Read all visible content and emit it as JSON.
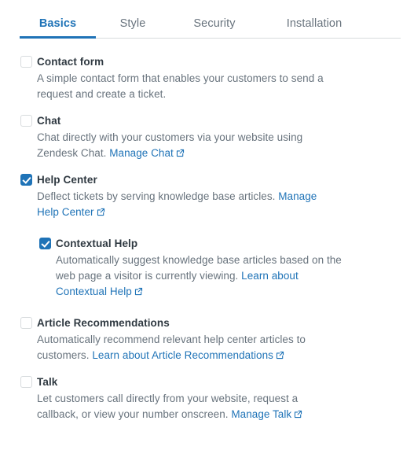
{
  "tabs": [
    {
      "label": "Basics",
      "active": true
    },
    {
      "label": "Style",
      "active": false
    },
    {
      "label": "Security",
      "active": false
    },
    {
      "label": "Installation",
      "active": false
    }
  ],
  "colors": {
    "accent": "#1f73b7",
    "title_text": "#2f3941",
    "body_text": "#68737d",
    "border": "#d8dcde",
    "background": "#ffffff"
  },
  "icons": {
    "external_link": "external-link-icon",
    "checkmark": "checkmark-icon"
  },
  "options": [
    {
      "title": "Contact form",
      "checked": false,
      "nested": false,
      "desc_text": "A simple contact form that enables your customers to send a request and create a ticket.",
      "link_text": "",
      "desc_tail": ""
    },
    {
      "title": "Chat",
      "checked": false,
      "nested": false,
      "desc_text": "Chat directly with your customers via your website using Zendesk Chat. ",
      "link_text": "Manage Chat",
      "desc_tail": ""
    },
    {
      "title": "Help Center",
      "checked": true,
      "nested": false,
      "desc_text": "Deflect tickets by serving knowledge base articles. ",
      "link_text": "Manage Help Center",
      "desc_tail": ""
    },
    {
      "title": "Contextual Help",
      "checked": true,
      "nested": true,
      "desc_text": "Automatically suggest knowledge base articles based on the web page a visitor is currently viewing. ",
      "link_text": "Learn about Contextual Help",
      "desc_tail": ""
    },
    {
      "title": "Article Recommendations",
      "checked": false,
      "nested": false,
      "desc_text": "Automatically recommend relevant help center articles to customers. ",
      "link_text": "Learn about Article Recommendations",
      "desc_tail": ""
    },
    {
      "title": "Talk",
      "checked": false,
      "nested": false,
      "desc_text": "Let customers call directly from your website, request a callback, or view your number onscreen. ",
      "link_text": "Manage Talk",
      "desc_tail": ""
    }
  ]
}
